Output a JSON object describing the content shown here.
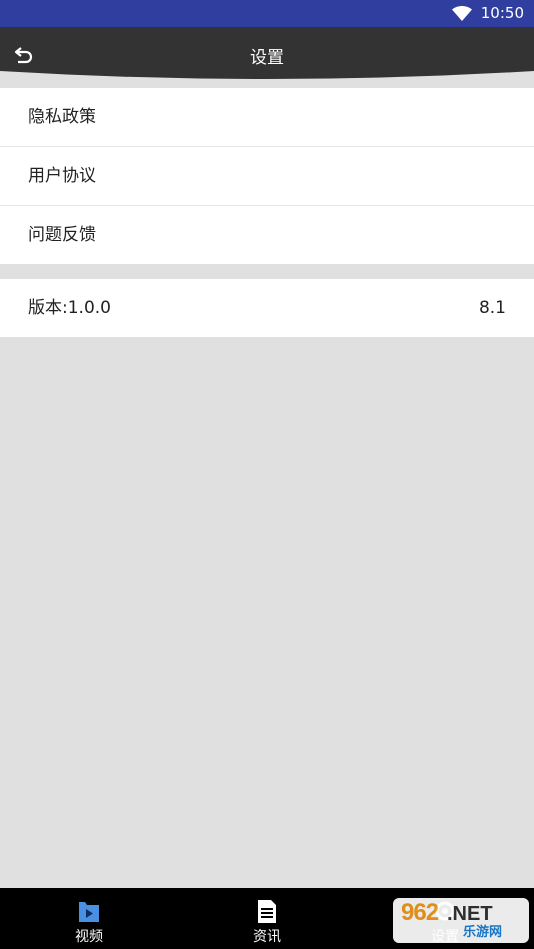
{
  "status_bar": {
    "time": "10:50",
    "wifi_icon": "wifi-icon"
  },
  "header": {
    "title": "设置",
    "back_icon": "back-arrow-icon"
  },
  "settings_group_1": [
    {
      "label": "隐私政策"
    },
    {
      "label": "用户协议"
    },
    {
      "label": "问题反馈"
    }
  ],
  "version_row": {
    "label": "版本:1.0.0",
    "value": "8.1"
  },
  "bottom_nav": [
    {
      "label": "视频",
      "icon": "video-icon",
      "selected": true
    },
    {
      "label": "资讯",
      "icon": "document-icon",
      "selected": false
    },
    {
      "label": "设置",
      "icon": "settings-icon",
      "selected": false
    }
  ],
  "watermark": {
    "brand": "962",
    "suffix": ".NET",
    "text": "乐游网"
  },
  "colors": {
    "status_bar": "#303f9f",
    "app_bar": "#333333",
    "background": "#e0e0e0",
    "nav_bar": "#000000",
    "nav_selected_icon": "#4a90e2"
  }
}
